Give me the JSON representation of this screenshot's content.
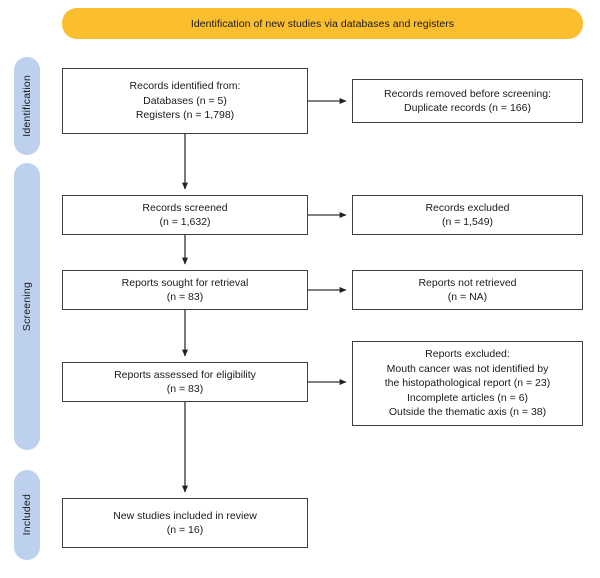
{
  "header": {
    "title": "Identification of new studies via databases and registers"
  },
  "stages": [
    {
      "id": "identification",
      "label": "Identification"
    },
    {
      "id": "screening",
      "label": "Screening"
    },
    {
      "id": "included",
      "label": "Included"
    }
  ],
  "boxes": {
    "identified": {
      "name": "records-identified-box",
      "lines": [
        "Records identified from:",
        "Databases (n = 5)",
        "Registers (n = 1,798)"
      ]
    },
    "removed": {
      "name": "records-removed-box",
      "lines": [
        "Records removed before screening:",
        "Duplicate records (n = 166)"
      ]
    },
    "screened": {
      "name": "records-screened-box",
      "lines": [
        "Records screened",
        "(n = 1,632)"
      ]
    },
    "excluded_records": {
      "name": "records-excluded-box",
      "lines": [
        "Records excluded",
        "(n = 1,549)"
      ]
    },
    "sought": {
      "name": "reports-sought-box",
      "lines": [
        "Reports sought for retrieval",
        "(n = 83)"
      ]
    },
    "not_retrieved": {
      "name": "reports-not-retrieved-box",
      "lines": [
        "Reports not retrieved",
        "(n = NA)"
      ]
    },
    "eligibility": {
      "name": "reports-assessed-box",
      "lines": [
        "Reports assessed for eligibility",
        "(n = 83)"
      ]
    },
    "excluded_reports": {
      "name": "reports-excluded-box",
      "lines": [
        "Reports excluded:",
        "Mouth cancer was not identified by",
        "the histopathological report (n = 23)",
        "Incomplete articles (n = 6)",
        "Outside the thematic axis (n = 38)"
      ]
    },
    "included": {
      "name": "new-studies-included-box",
      "lines": [
        "New studies included in review",
        "(n = 16)"
      ]
    }
  },
  "colors": {
    "banner": "#FBBE2E",
    "stage_pill": "#BDD1EE",
    "box_border": "#3F3F3F",
    "text": "#1A1A1A",
    "connector": "#333333",
    "background": "#FFFFFF"
  }
}
